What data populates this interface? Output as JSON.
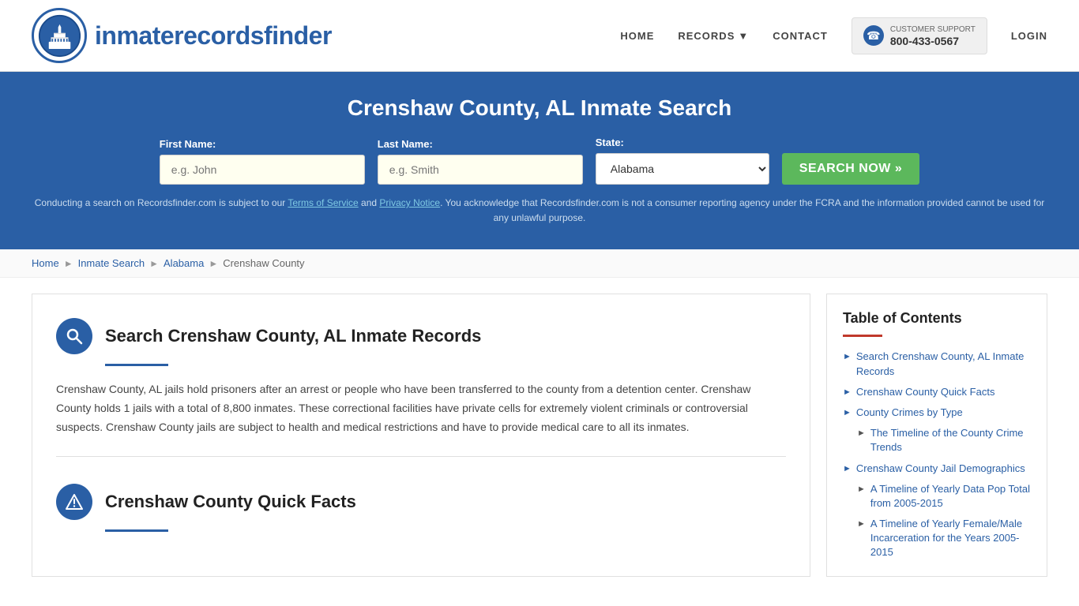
{
  "header": {
    "logo_text_regular": "inmaterecords",
    "logo_text_bold": "finder",
    "nav": {
      "home_label": "HOME",
      "records_label": "RECORDS",
      "contact_label": "CONTACT",
      "support_label": "CUSTOMER SUPPORT",
      "support_number": "800-433-0567",
      "login_label": "LOGIN"
    }
  },
  "hero": {
    "title": "Crenshaw County, AL Inmate Search",
    "first_name_label": "First Name:",
    "first_name_placeholder": "e.g. John",
    "last_name_label": "Last Name:",
    "last_name_placeholder": "e.g. Smith",
    "state_label": "State:",
    "state_value": "Alabama",
    "search_btn_label": "SEARCH NOW »",
    "disclaimer": "Conducting a search on Recordsfinder.com is subject to our Terms of Service and Privacy Notice. You acknowledge that Recordsfinder.com is not a consumer reporting agency under the FCRA and the information provided cannot be used for any unlawful purpose.",
    "terms_label": "Terms of Service",
    "privacy_label": "Privacy Notice"
  },
  "breadcrumb": {
    "home": "Home",
    "inmate_search": "Inmate Search",
    "alabama": "Alabama",
    "current": "Crenshaw County"
  },
  "main_section": {
    "title": "Search Crenshaw County, AL Inmate Records",
    "body": "Crenshaw County, AL jails hold prisoners after an arrest or people who have been transferred to the county from a detention center. Crenshaw County holds 1 jails with a total of 8,800 inmates. These correctional facilities have private cells for extremely violent criminals or controversial suspects. Crenshaw County jails are subject to health and medical restrictions and have to provide medical care to all its inmates."
  },
  "second_section": {
    "title": "Crenshaw County Quick Facts"
  },
  "toc": {
    "title": "Table of Contents",
    "items": [
      {
        "label": "Search Crenshaw County, AL Inmate Records",
        "indent": false
      },
      {
        "label": "Crenshaw County Quick Facts",
        "indent": false
      },
      {
        "label": "County Crimes by Type",
        "indent": false
      },
      {
        "label": "The Timeline of the County Crime Trends",
        "indent": true
      },
      {
        "label": "Crenshaw County Jail Demographics",
        "indent": false
      },
      {
        "label": "A Timeline of Yearly Data Pop Total from 2005-2015",
        "indent": true
      },
      {
        "label": "A Timeline of Yearly Female/Male Incarceration for the Years 2005-2015",
        "indent": true
      }
    ]
  }
}
